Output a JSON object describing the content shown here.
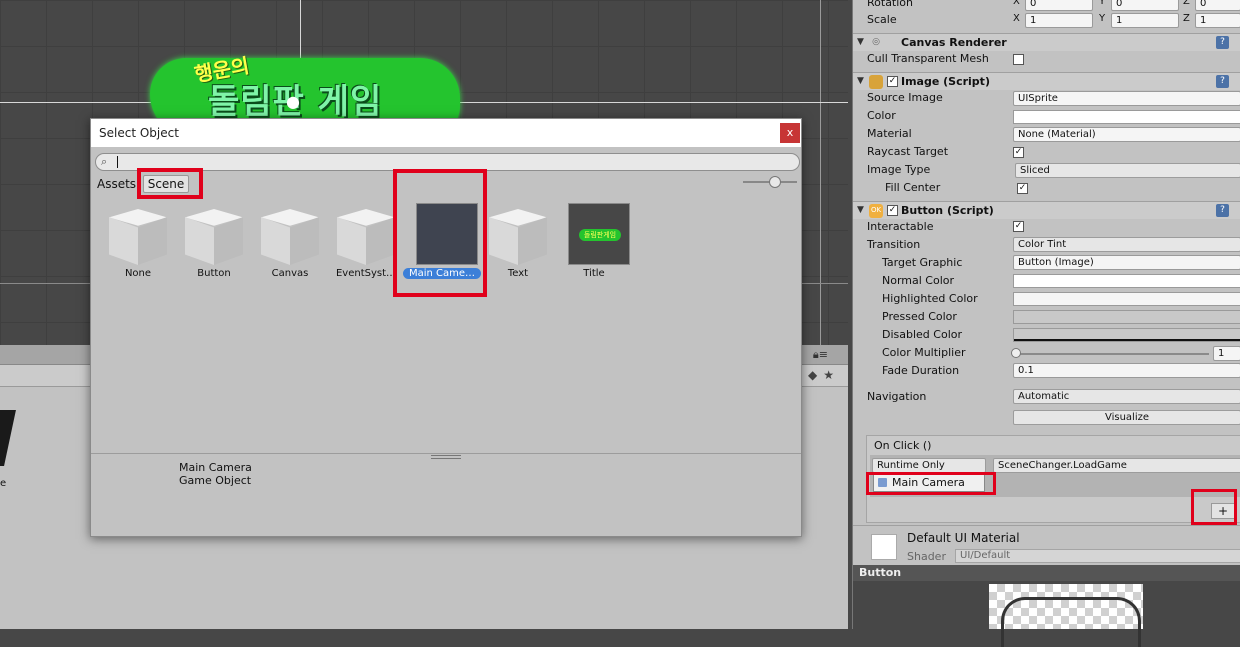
{
  "scene_view": {
    "title_sub": "행운의",
    "title_main": "돌림판 게임"
  },
  "dialog": {
    "title": "Select Object",
    "close_label": "x",
    "search_value": "",
    "tabs": {
      "assets": "Assets",
      "scene": "Scene"
    },
    "items": [
      {
        "label": "None",
        "kind": "cube"
      },
      {
        "label": "Button",
        "kind": "cube"
      },
      {
        "label": "Canvas",
        "kind": "cube"
      },
      {
        "label": "EventSyst…",
        "kind": "cube"
      },
      {
        "label": "Main Came…",
        "kind": "camera",
        "selected": true
      },
      {
        "label": "Text",
        "kind": "cube"
      },
      {
        "label": "Title",
        "kind": "image"
      }
    ],
    "title_thumb_text": "돌림판게임",
    "info_name": "Main Camera",
    "info_type": "Game Object"
  },
  "lower_panel": {
    "fragment_label": "e"
  },
  "inspector": {
    "transform": {
      "rotation_label": "Rotation",
      "rotation": {
        "x": "0",
        "y": "0",
        "z": "0"
      },
      "scale_label": "Scale",
      "scale": {
        "x": "1",
        "y": "1",
        "z": "1"
      }
    },
    "canvas_renderer": {
      "title": "Canvas Renderer",
      "cull_label": "Cull Transparent Mesh"
    },
    "image": {
      "title": "Image (Script)",
      "source_image_label": "Source Image",
      "source_image": "UISprite",
      "color_label": "Color",
      "material_label": "Material",
      "material": "None (Material)",
      "raycast_label": "Raycast Target",
      "image_type_label": "Image Type",
      "image_type": "Sliced",
      "fill_center_label": "Fill Center"
    },
    "button": {
      "title": "Button (Script)",
      "interactable_label": "Interactable",
      "transition_label": "Transition",
      "transition": "Color Tint",
      "target_graphic_label": "Target Graphic",
      "target_graphic": "Button (Image)",
      "normal_color_label": "Normal Color",
      "highlighted_color_label": "Highlighted Color",
      "pressed_color_label": "Pressed Color",
      "disabled_color_label": "Disabled Color",
      "color_multiplier_label": "Color Multiplier",
      "color_multiplier": "1",
      "fade_duration_label": "Fade Duration",
      "fade_duration": "0.1",
      "navigation_label": "Navigation",
      "navigation": "Automatic",
      "visualize_label": "Visualize"
    },
    "on_click": {
      "label": "On Click ()",
      "runtime": "Runtime Only",
      "function": "SceneChanger.LoadGame",
      "object": "Main Camera",
      "add_label": "+"
    },
    "material": {
      "name": "Default UI Material",
      "shader_label": "Shader",
      "shader": "UI/Default"
    },
    "preview": {
      "label": "Button"
    }
  },
  "colors": {
    "highlight": "#e0001b",
    "selection": "#3c7fd8",
    "title_green": "#24c42e"
  }
}
